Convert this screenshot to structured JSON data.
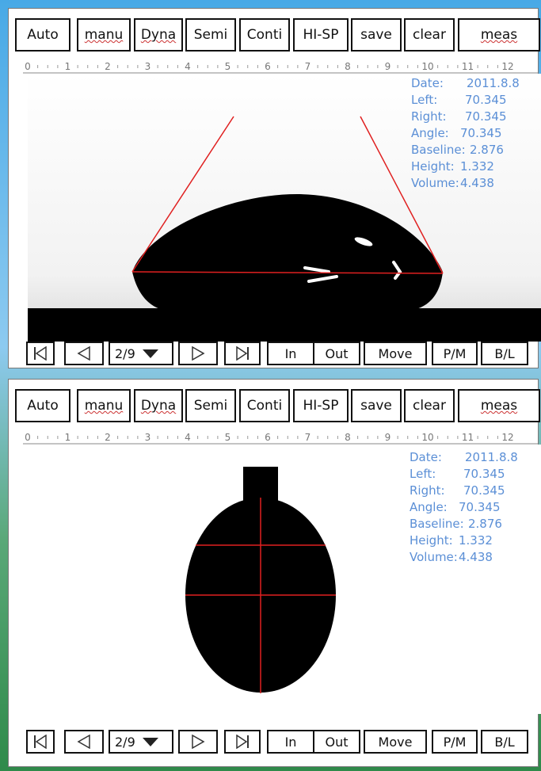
{
  "toolbar": {
    "auto": "Auto",
    "manu": "manu",
    "dyna": "Dyna",
    "semi": "Semi",
    "conti": "Conti",
    "hisp": "HI-SP",
    "save": "save",
    "clear": "clear",
    "meas": "meas"
  },
  "ruler": {
    "labels": [
      "0",
      "1",
      "2",
      "3",
      "4",
      "5",
      "6",
      "7",
      "8",
      "9",
      "10",
      "11",
      "12"
    ]
  },
  "measurements": {
    "date_label": "Date:",
    "date": "2011.8.8",
    "left_label": "Left:",
    "left": "70.345",
    "right_label": "Right:",
    "right": "70.345",
    "angle_label": "Angle:",
    "angle": "70.345",
    "baseline_label": "Baseline:",
    "baseline": "2.876",
    "height_label": "Height:",
    "height": "1.332",
    "volume_label": "Volume:",
    "volume": "4.438"
  },
  "controls": {
    "first_icon": "skip-to-first-icon",
    "prev_icon": "previous-icon",
    "frame": "2/9",
    "dropdown_icon": "dropdown-arrow-icon",
    "next_icon": "next-icon",
    "last_icon": "skip-to-last-icon",
    "zoom_in": "In",
    "zoom_out": "Out",
    "move": "Move",
    "pm": "P/M",
    "bl": "B/L"
  },
  "colors": {
    "info_text": "#5b8fd6",
    "guide_line": "#e02020",
    "droplet": "#000000"
  }
}
